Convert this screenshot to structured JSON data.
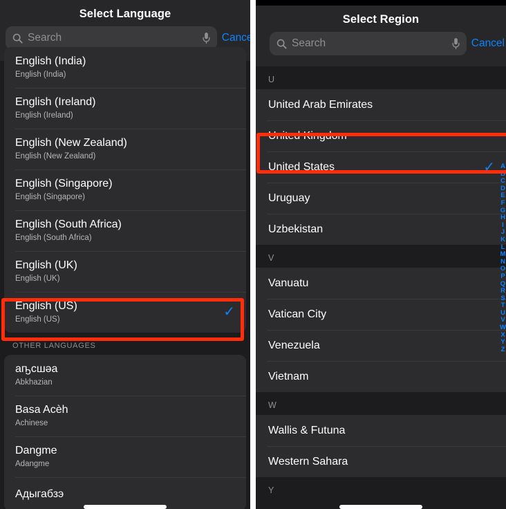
{
  "left_panel": {
    "title": "Select Language",
    "search": {
      "placeholder": "Search",
      "cancel_label": "Cancel",
      "value": ""
    },
    "icons": {
      "search": "search-icon",
      "mic": "microphone-icon",
      "check": "checkmark-icon"
    },
    "languages": [
      {
        "name": "English (India)",
        "sub": "English (India)",
        "selected": false
      },
      {
        "name": "English (Ireland)",
        "sub": "English (Ireland)",
        "selected": false
      },
      {
        "name": "English (New Zealand)",
        "sub": "English (New Zealand)",
        "selected": false
      },
      {
        "name": "English (Singapore)",
        "sub": "English (Singapore)",
        "selected": false
      },
      {
        "name": "English (South Africa)",
        "sub": "English (South Africa)",
        "selected": false
      },
      {
        "name": "English (UK)",
        "sub": "English (UK)",
        "selected": false
      },
      {
        "name": "English (US)",
        "sub": "English (US)",
        "selected": true
      }
    ],
    "other_languages_header": "OTHER LANGUAGES",
    "other_languages": [
      {
        "name": "аҧсшәа",
        "sub": "Abkhazian",
        "selected": false
      },
      {
        "name": "Basa Acèh",
        "sub": "Achinese",
        "selected": false
      },
      {
        "name": "Dangme",
        "sub": "Adangme",
        "selected": false
      },
      {
        "name": "Адыгабзэ",
        "sub": "",
        "selected": false
      }
    ],
    "checkmark_glyph": "✓"
  },
  "right_panel": {
    "title": "Select Region",
    "search": {
      "placeholder": "Search",
      "cancel_label": "Cancel",
      "value": ""
    },
    "sections": [
      {
        "letter": "U",
        "regions": [
          {
            "name": "United Arab Emirates",
            "selected": false
          },
          {
            "name": "United Kingdom",
            "selected": false
          },
          {
            "name": "United States",
            "selected": true
          },
          {
            "name": "Uruguay",
            "selected": false
          },
          {
            "name": "Uzbekistan",
            "selected": false
          }
        ]
      },
      {
        "letter": "V",
        "regions": [
          {
            "name": "Vanuatu",
            "selected": false
          },
          {
            "name": "Vatican City",
            "selected": false
          },
          {
            "name": "Venezuela",
            "selected": false
          },
          {
            "name": "Vietnam",
            "selected": false
          }
        ]
      },
      {
        "letter": "W",
        "regions": [
          {
            "name": "Wallis & Futuna",
            "selected": false
          },
          {
            "name": "Western Sahara",
            "selected": false
          }
        ]
      },
      {
        "letter": "Y",
        "regions": []
      }
    ],
    "index_strip": [
      "A",
      "B",
      "C",
      "D",
      "E",
      "F",
      "G",
      "H",
      "I",
      "J",
      "K",
      "L",
      "M",
      "N",
      "O",
      "P",
      "Q",
      "R",
      "S",
      "T",
      "U",
      "V",
      "W",
      "X",
      "Y",
      "Z"
    ],
    "checkmark_glyph": "✓"
  },
  "highlights": {
    "left_target": "English (US)",
    "right_target": "United States",
    "color": "#ff2d0a"
  },
  "colors": {
    "accent_blue": "#0a84ff",
    "row_background": "#2c2c2e",
    "page_background": "#1c1c1e",
    "nav_background": "#272729",
    "separator": "#3a3a3c",
    "secondary_text": "#8e8e93"
  }
}
